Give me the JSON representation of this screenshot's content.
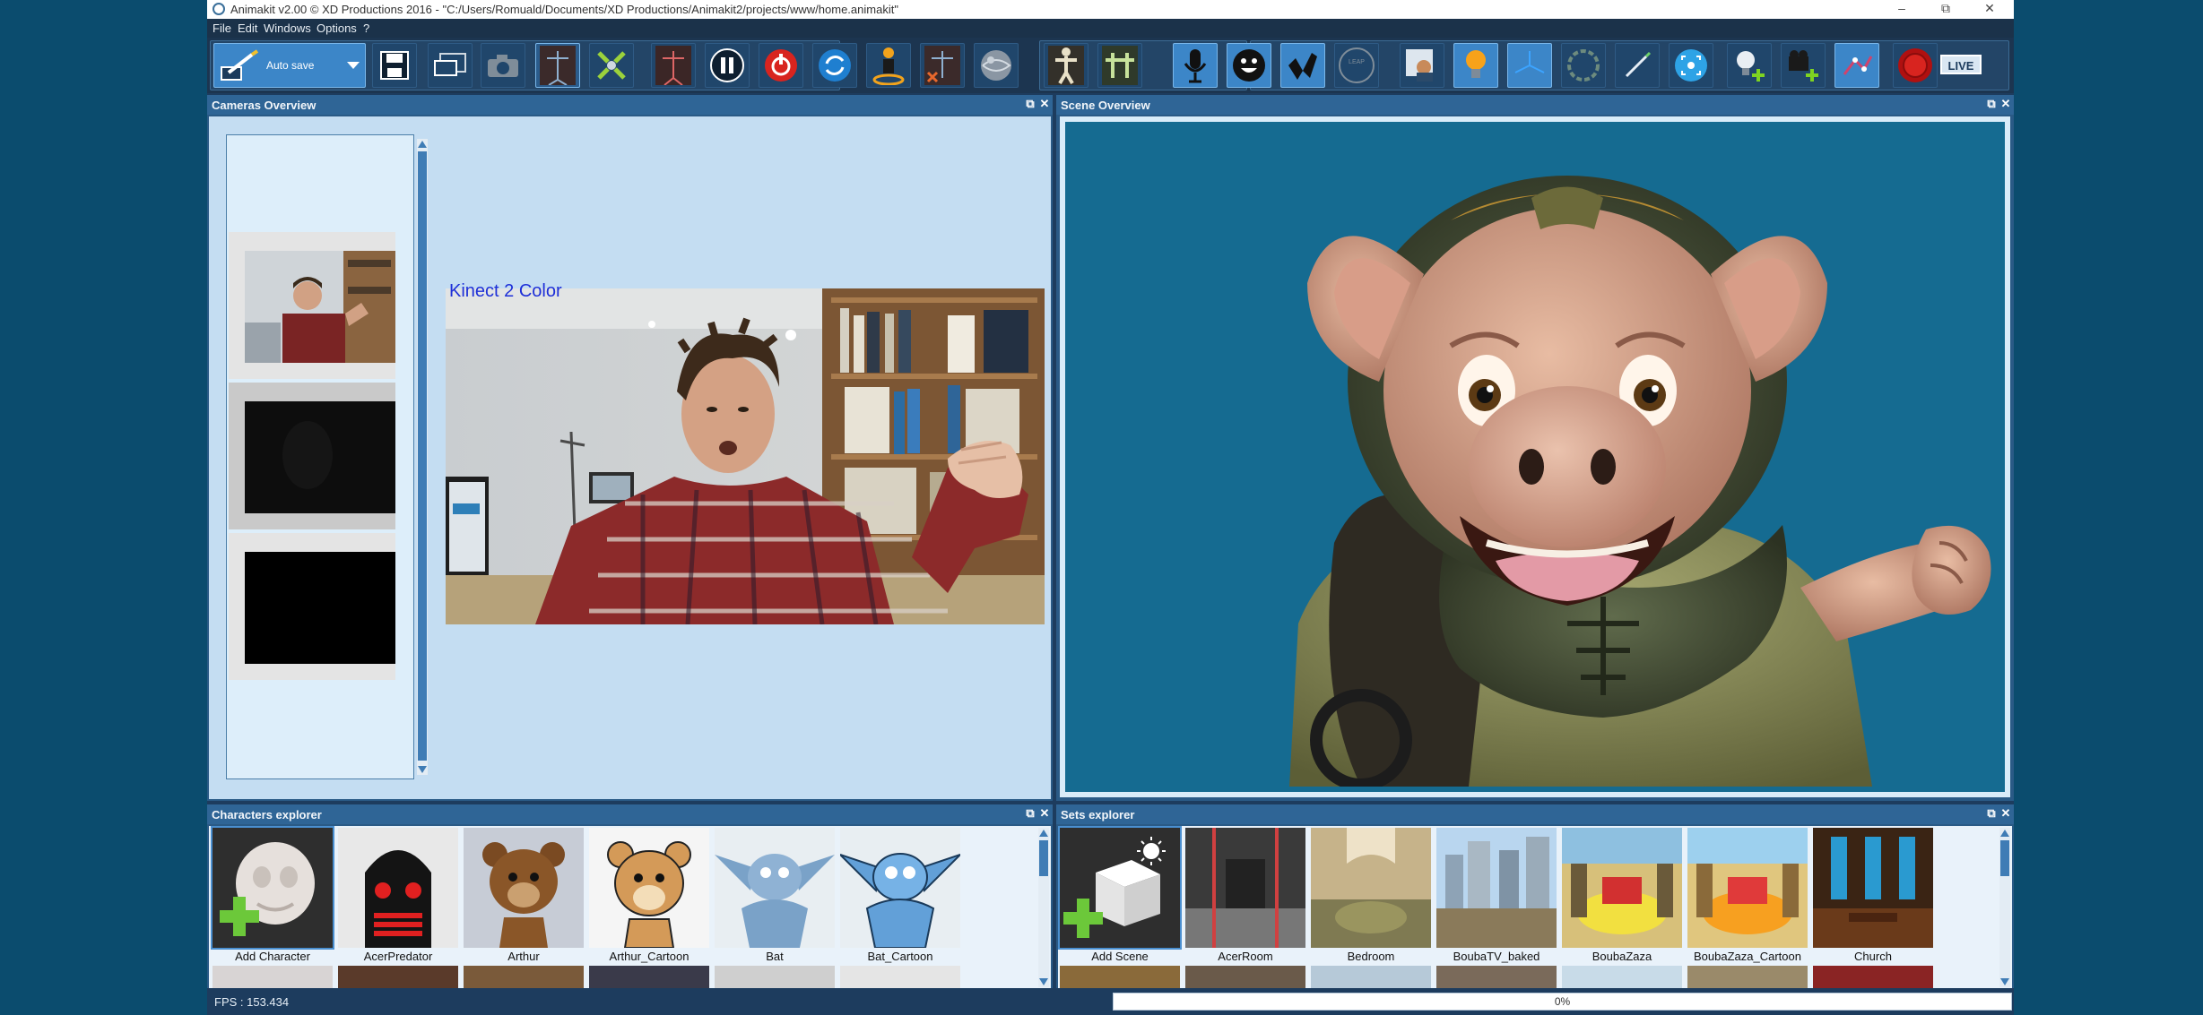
{
  "window": {
    "title": "Animakit v2.00 © XD Productions 2016 - \"C:/Users/Romuald/Documents/XD Productions/Animakit2/projects/www/home.animakit\"",
    "controls": [
      "minimize",
      "restore",
      "close"
    ]
  },
  "menu": {
    "items": [
      "File",
      "Edit",
      "Windows",
      "Options",
      "?"
    ]
  },
  "toolbar": {
    "autosave_label": "Auto save",
    "live_label": "LIVE",
    "buttons": [
      {
        "name": "save-icon",
        "active": false
      },
      {
        "name": "screen-capture-icon",
        "active": false
      },
      {
        "name": "camera-icon",
        "active": false
      },
      {
        "name": "skeleton-view-icon",
        "active": true
      },
      {
        "name": "calibrate-icon",
        "active": false
      },
      {
        "name": "skeleton-record-icon",
        "active": false
      },
      {
        "name": "pause-icon",
        "active": false
      },
      {
        "name": "power-icon",
        "active": false
      },
      {
        "name": "refresh-icon",
        "active": false
      },
      {
        "name": "tracking-person-icon",
        "active": false
      },
      {
        "name": "delete-skeleton-icon",
        "active": false
      },
      {
        "name": "sphere-icon",
        "active": false
      },
      {
        "name": "body-tracking-icon",
        "active": false
      },
      {
        "name": "two-body-icon",
        "active": false
      },
      {
        "name": "microphone-icon",
        "active": true
      },
      {
        "name": "face-icon",
        "active": true
      },
      {
        "name": "hands-icon",
        "active": true
      },
      {
        "name": "leap-motion-icon",
        "active": false
      },
      {
        "name": "background-image-icon",
        "active": false
      },
      {
        "name": "light-bulb-icon",
        "active": true
      },
      {
        "name": "axis-icon",
        "active": true
      },
      {
        "name": "orbit-icon",
        "active": false
      },
      {
        "name": "pen-icon",
        "active": false
      },
      {
        "name": "focus-icon",
        "active": false
      },
      {
        "name": "add-light-icon",
        "active": false
      },
      {
        "name": "add-camera-icon",
        "active": false
      },
      {
        "name": "rig-icon",
        "active": true
      },
      {
        "name": "record-icon",
        "active": false
      }
    ]
  },
  "panels": {
    "cameras": {
      "title": "Cameras Overview",
      "main_label": "Kinect 2 Color"
    },
    "scene": {
      "title": "Scene Overview"
    },
    "characters": {
      "title": "Characters explorer",
      "items": [
        "Add Character",
        "AcerPredator",
        "Arthur",
        "Arthur_Cartoon",
        "Bat",
        "Bat_Cartoon"
      ]
    },
    "sets": {
      "title": "Sets explorer",
      "items": [
        "Add Scene",
        "AcerRoom",
        "Bedroom",
        "BoubaTV_baked",
        "BoubaZaza",
        "BoubaZaza_Cartoon",
        "Church"
      ]
    }
  },
  "status": {
    "fps": "FPS : 153.434",
    "progress_text": "0%",
    "progress_value": 0
  },
  "colors": {
    "accent": "#3c86c8",
    "panel_header": "#2f6596",
    "app_bg": "#1d3c5e",
    "scene_bg": "#156b91"
  }
}
